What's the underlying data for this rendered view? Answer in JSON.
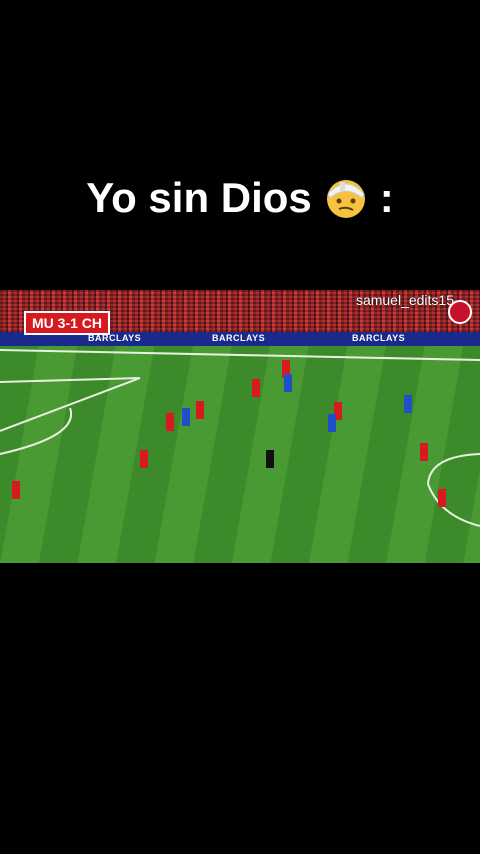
{
  "caption": {
    "text": "Yo sin Dios",
    "emoji": "head-bandage-emoji",
    "suffix": ":"
  },
  "video": {
    "scoreboard": "MU 3-1 CH",
    "watermark": "samuel_edits15",
    "ad_boards": [
      "BARCLAYS",
      "BARCLAYS",
      "BARCLAYS",
      "BARCLAYS"
    ],
    "colors": {
      "home_kit": "#d71920",
      "away_kit": "#2050c8",
      "referee": "#111111",
      "pitch": "#4a9a33"
    }
  }
}
